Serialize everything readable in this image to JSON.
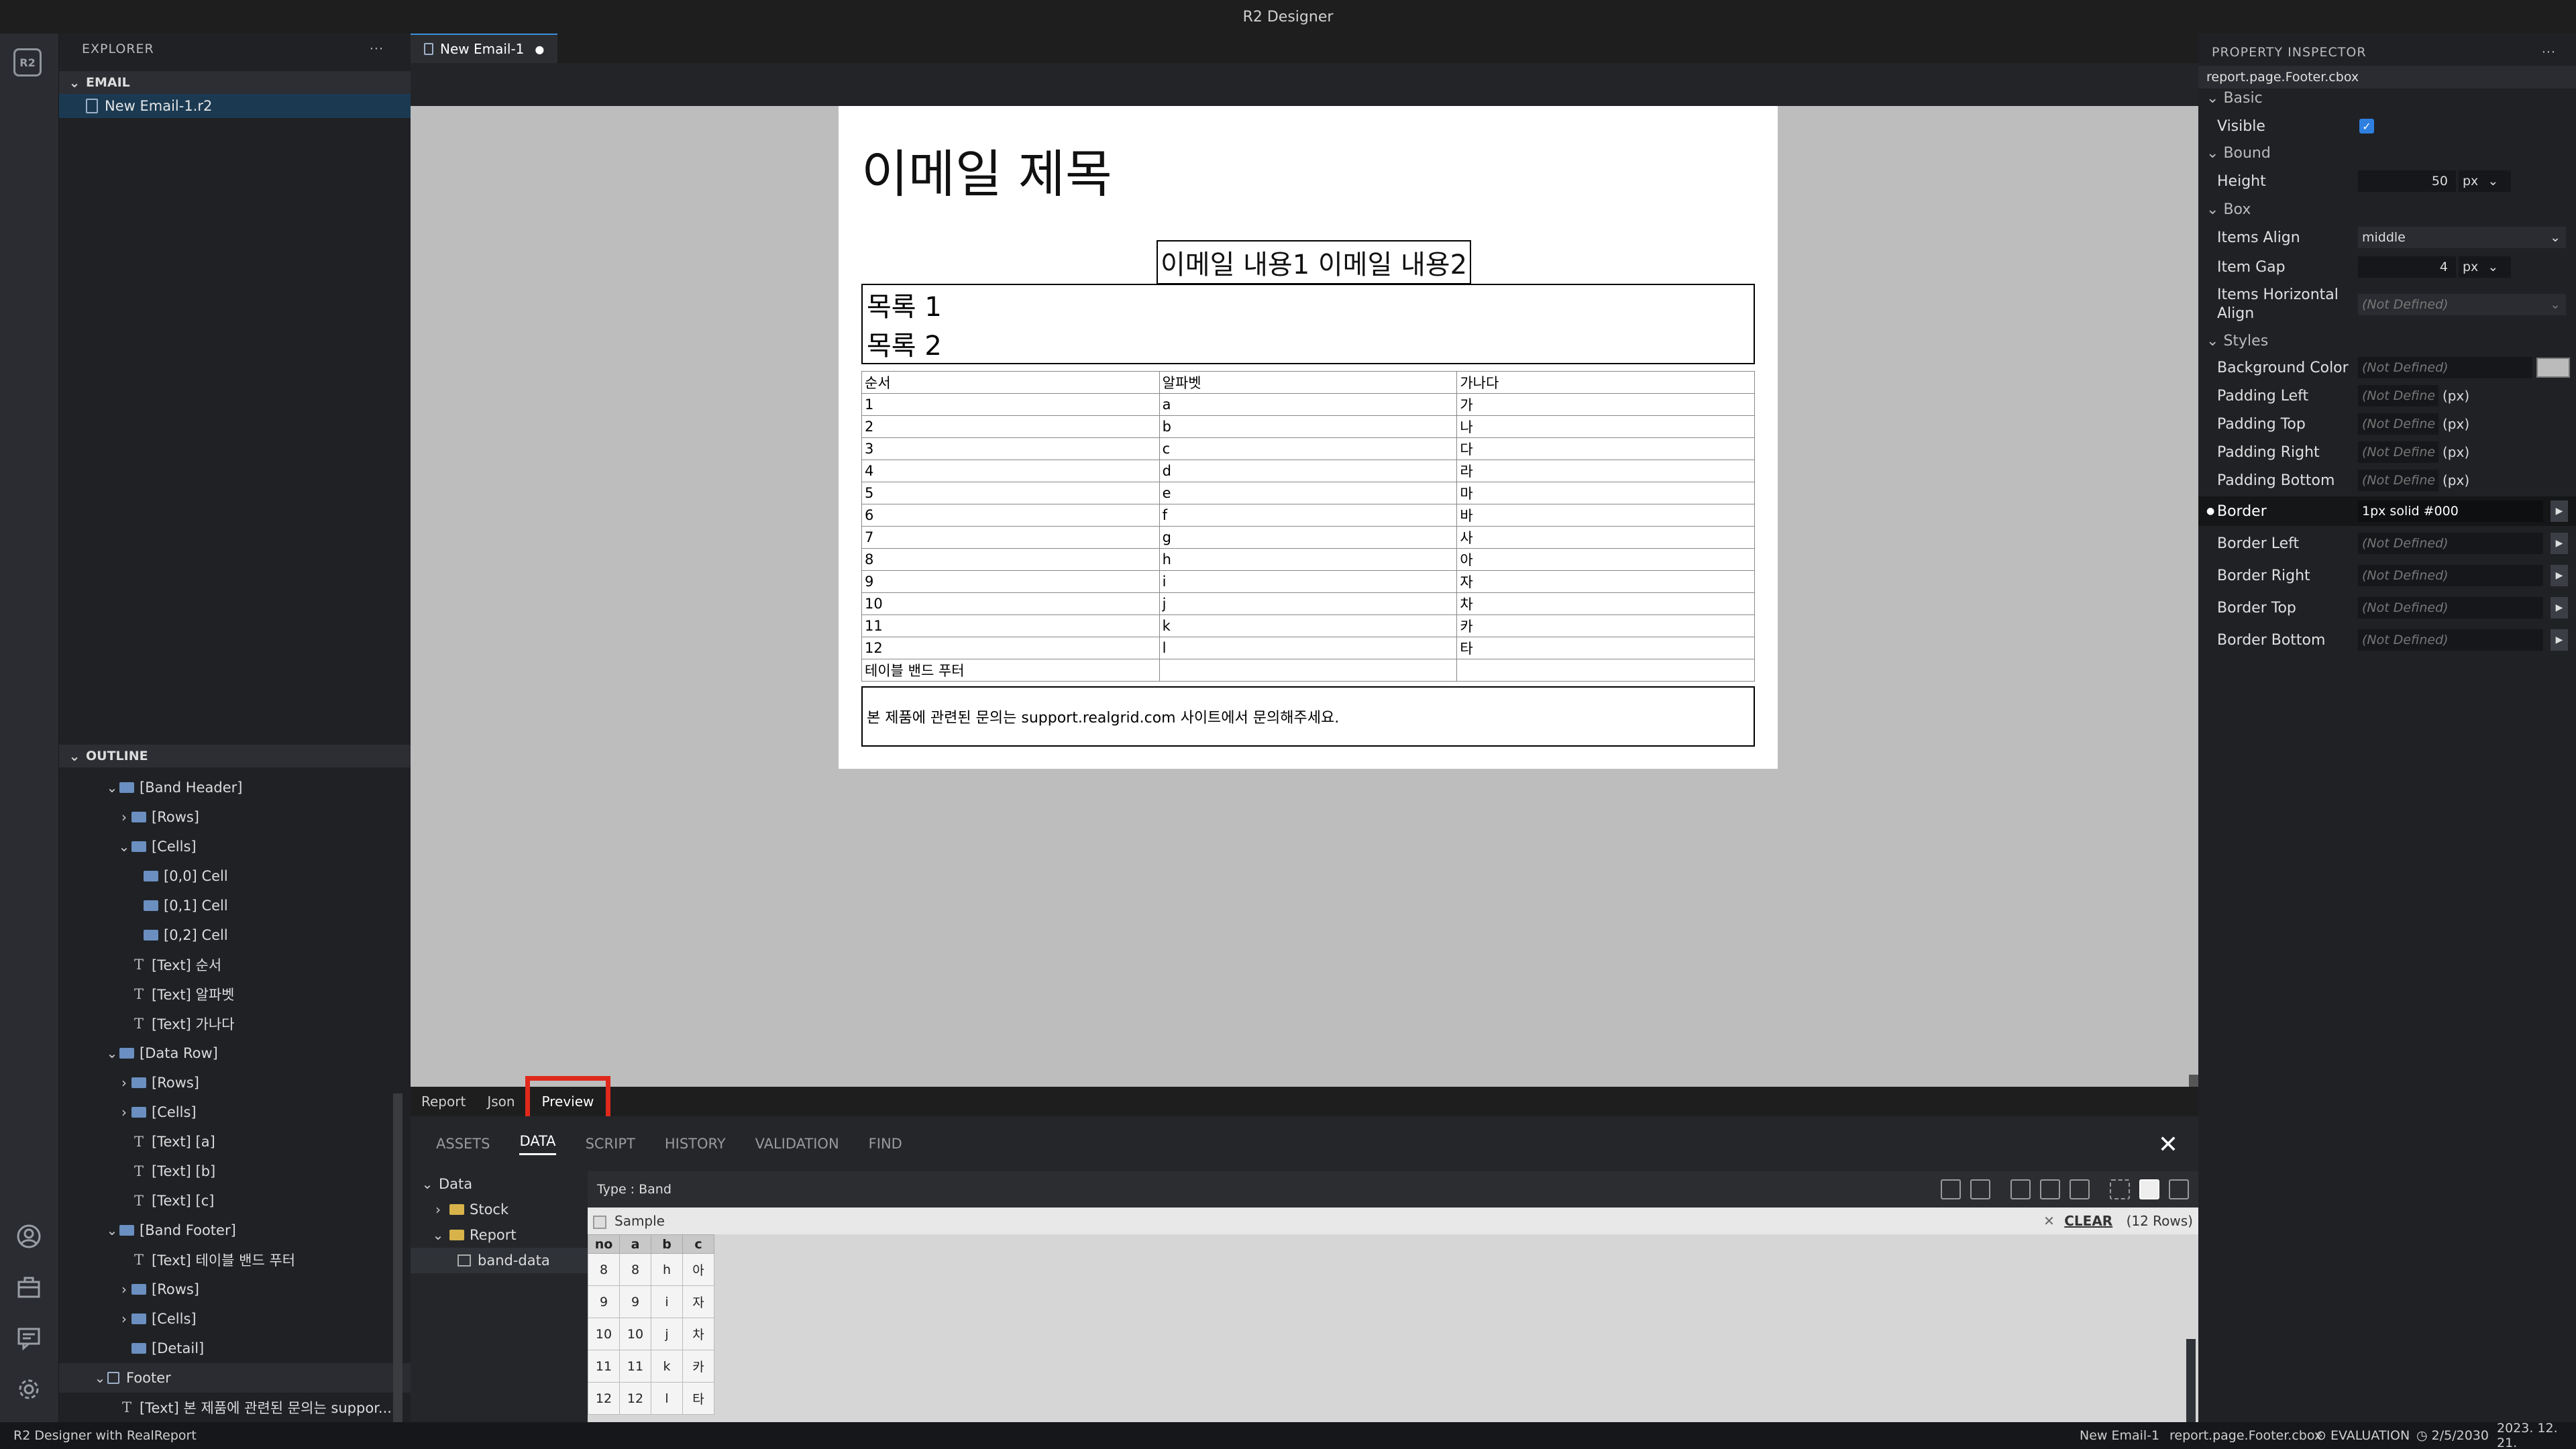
{
  "window_title": "R2 Designer",
  "explorer": {
    "title": "EXPLORER",
    "more": "···",
    "email_section": "EMAIL",
    "file": "New Email-1.r2"
  },
  "outline": {
    "title": "OUTLINE",
    "items": [
      {
        "label": "[Band Header]",
        "indent": 1,
        "chev": "⌄",
        "icon": "folder"
      },
      {
        "label": "[Rows]",
        "indent": 2,
        "chev": "›",
        "icon": "folder"
      },
      {
        "label": "[Cells]",
        "indent": 2,
        "chev": "⌄",
        "icon": "folder"
      },
      {
        "label": "[0,0] Cell",
        "indent": 3,
        "chev": "",
        "icon": "folder"
      },
      {
        "label": "[0,1] Cell",
        "indent": 3,
        "chev": "",
        "icon": "folder"
      },
      {
        "label": "[0,2] Cell",
        "indent": 3,
        "chev": "",
        "icon": "folder"
      },
      {
        "label": "[Text] 순서",
        "indent": 2,
        "chev": "",
        "icon": "text"
      },
      {
        "label": "[Text] 알파벳",
        "indent": 2,
        "chev": "",
        "icon": "text"
      },
      {
        "label": "[Text] 가나다",
        "indent": 2,
        "chev": "",
        "icon": "text"
      },
      {
        "label": "[Data Row]",
        "indent": 1,
        "chev": "⌄",
        "icon": "folder"
      },
      {
        "label": "[Rows]",
        "indent": 2,
        "chev": "›",
        "icon": "folder"
      },
      {
        "label": "[Cells]",
        "indent": 2,
        "chev": "›",
        "icon": "folder"
      },
      {
        "label": "[Text] [a]",
        "indent": 2,
        "chev": "",
        "icon": "text"
      },
      {
        "label": "[Text] [b]",
        "indent": 2,
        "chev": "",
        "icon": "text"
      },
      {
        "label": "[Text] [c]",
        "indent": 2,
        "chev": "",
        "icon": "text"
      },
      {
        "label": "[Band Footer]",
        "indent": 1,
        "chev": "⌄",
        "icon": "folder"
      },
      {
        "label": "[Text] 테이블 밴드 푸터",
        "indent": 2,
        "chev": "",
        "icon": "text"
      },
      {
        "label": "[Rows]",
        "indent": 2,
        "chev": "›",
        "icon": "folder"
      },
      {
        "label": "[Cells]",
        "indent": 2,
        "chev": "›",
        "icon": "folder"
      },
      {
        "label": "[Detail]",
        "indent": 2,
        "chev": "",
        "icon": "folder"
      },
      {
        "label": "Footer",
        "indent": 0,
        "chev": "⌄",
        "icon": "footer"
      },
      {
        "label": "[Text] 본 제품에 관련된 문의는 suppor...",
        "indent": 1,
        "chev": "",
        "icon": "text"
      }
    ]
  },
  "editor": {
    "tab_label": "New Email-1",
    "tab_dirty": "●",
    "doc_tabs": [
      "Report",
      "Json",
      "Preview"
    ]
  },
  "report": {
    "title": "이메일 제목",
    "subtitle": "이메일 내용1 이메일 내용2",
    "list": [
      "목록 1",
      "목록 2"
    ],
    "table_header": [
      "순서",
      "알파벳",
      "가나다"
    ],
    "table_rows": [
      [
        "1",
        "a",
        "가"
      ],
      [
        "2",
        "b",
        "나"
      ],
      [
        "3",
        "c",
        "다"
      ],
      [
        "4",
        "d",
        "라"
      ],
      [
        "5",
        "e",
        "마"
      ],
      [
        "6",
        "f",
        "바"
      ],
      [
        "7",
        "g",
        "사"
      ],
      [
        "8",
        "h",
        "아"
      ],
      [
        "9",
        "i",
        "자"
      ],
      [
        "10",
        "j",
        "차"
      ],
      [
        "11",
        "k",
        "카"
      ],
      [
        "12",
        "l",
        "타"
      ]
    ],
    "table_footer": "테이블 밴드 푸터",
    "footer_text": "본 제품에 관련된 문의는 support.realgrid.com 사이트에서 문의해주세요."
  },
  "bottom_panel": {
    "tabs": [
      "ASSETS",
      "DATA",
      "SCRIPT",
      "HISTORY",
      "VALIDATION",
      "FIND"
    ],
    "close": "✕",
    "tree": {
      "root": "Data",
      "stock": "Stock",
      "report": "Report",
      "band_data": "band-data"
    },
    "type_label": "Type : Band",
    "sample_label": "Sample",
    "clear_label": "CLEAR",
    "rows_count": "(12 Rows)",
    "grid_columns": [
      "no",
      "a",
      "b",
      "c"
    ],
    "grid_rows": [
      [
        "8",
        "8",
        "h",
        "아"
      ],
      [
        "9",
        "9",
        "i",
        "자"
      ],
      [
        "10",
        "10",
        "j",
        "차"
      ],
      [
        "11",
        "11",
        "k",
        "카"
      ],
      [
        "12",
        "12",
        "l",
        "타"
      ]
    ]
  },
  "inspector": {
    "title": "PROPERTY INSPECTOR",
    "more": "···",
    "path": "report.page.Footer.cbox",
    "groups": {
      "basic": "Basic",
      "bound": "Bound",
      "box": "Box",
      "styles": "Styles"
    },
    "visible_label": "Visible",
    "height_label": "Height",
    "height_value": "50",
    "height_unit": "px",
    "items_align_label": "Items Align",
    "items_align_value": "middle",
    "item_gap_label": "Item Gap",
    "item_gap_value": "4",
    "item_gap_unit": "px",
    "items_h_align_label": "Items Horizontal Align",
    "not_defined": "(Not Defined)",
    "not_define_short": "(Not Define",
    "px_suffix": "(px)",
    "background_color_label": "Background Color",
    "padding_left_label": "Padding Left",
    "padding_top_label": "Padding Top",
    "padding_right_label": "Padding Right",
    "padding_bottom_label": "Padding Bottom",
    "border_label": "Border",
    "border_value": "1px solid #000",
    "border_left_label": "Border Left",
    "border_right_label": "Border Right",
    "border_top_label": "Border Top",
    "border_bottom_label": "Border Bottom"
  },
  "status_bar": {
    "left": "R2 Designer with RealReport",
    "file": "New Email-1",
    "path": "report.page.Footer.cbox",
    "evaluation": "EVALUATION",
    "expire": "2/5/2030",
    "date": "2023. 12. 21."
  },
  "colors": {
    "accent": "#3b8fd9",
    "highlight_box": "#e0291c"
  }
}
